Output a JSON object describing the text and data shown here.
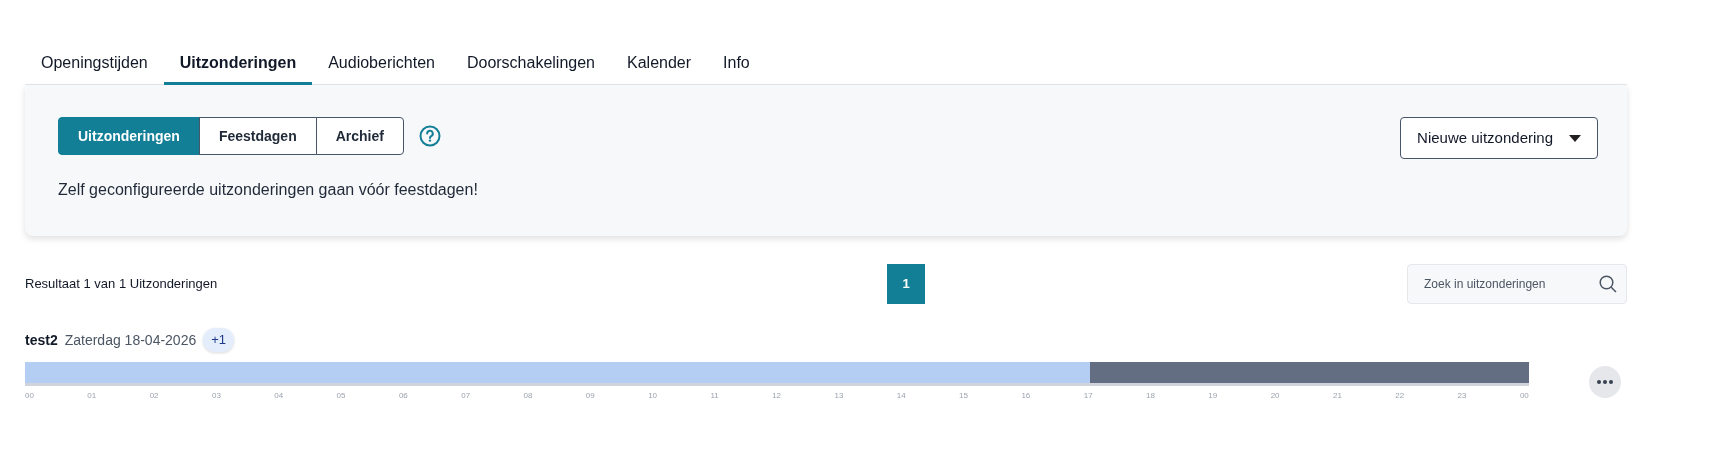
{
  "tabs": [
    {
      "label": "Openingstijden",
      "selected": false
    },
    {
      "label": "Uitzonderingen",
      "selected": true
    },
    {
      "label": "Audioberichten",
      "selected": false
    },
    {
      "label": "Doorschakelingen",
      "selected": false
    },
    {
      "label": "Kalender",
      "selected": false
    },
    {
      "label": "Info",
      "selected": false
    }
  ],
  "segments": [
    {
      "label": "Uitzonderingen",
      "selected": true
    },
    {
      "label": "Feestdagen",
      "selected": false
    },
    {
      "label": "Archief",
      "selected": false
    }
  ],
  "notice": "Zelf geconfigureerde uitzonderingen gaan vóór feestdagen!",
  "new_button": "Nieuwe uitzondering",
  "result_text": "Resultaat 1 van 1 Uitzonderingen",
  "pages": [
    {
      "label": "1",
      "selected": true
    }
  ],
  "search": {
    "placeholder": "Zoek in uitzonderingen"
  },
  "exceptions": [
    {
      "name": "test2",
      "date": "Zaterdag 18-04-2026",
      "extra": "+1",
      "level": 0.7083,
      "ticks": [
        "00",
        "01",
        "02",
        "03",
        "04",
        "05",
        "06",
        "07",
        "08",
        "09",
        "10",
        "11",
        "12",
        "13",
        "14",
        "15",
        "16",
        "17",
        "18",
        "19",
        "20",
        "21",
        "22",
        "23",
        "00"
      ]
    }
  ]
}
